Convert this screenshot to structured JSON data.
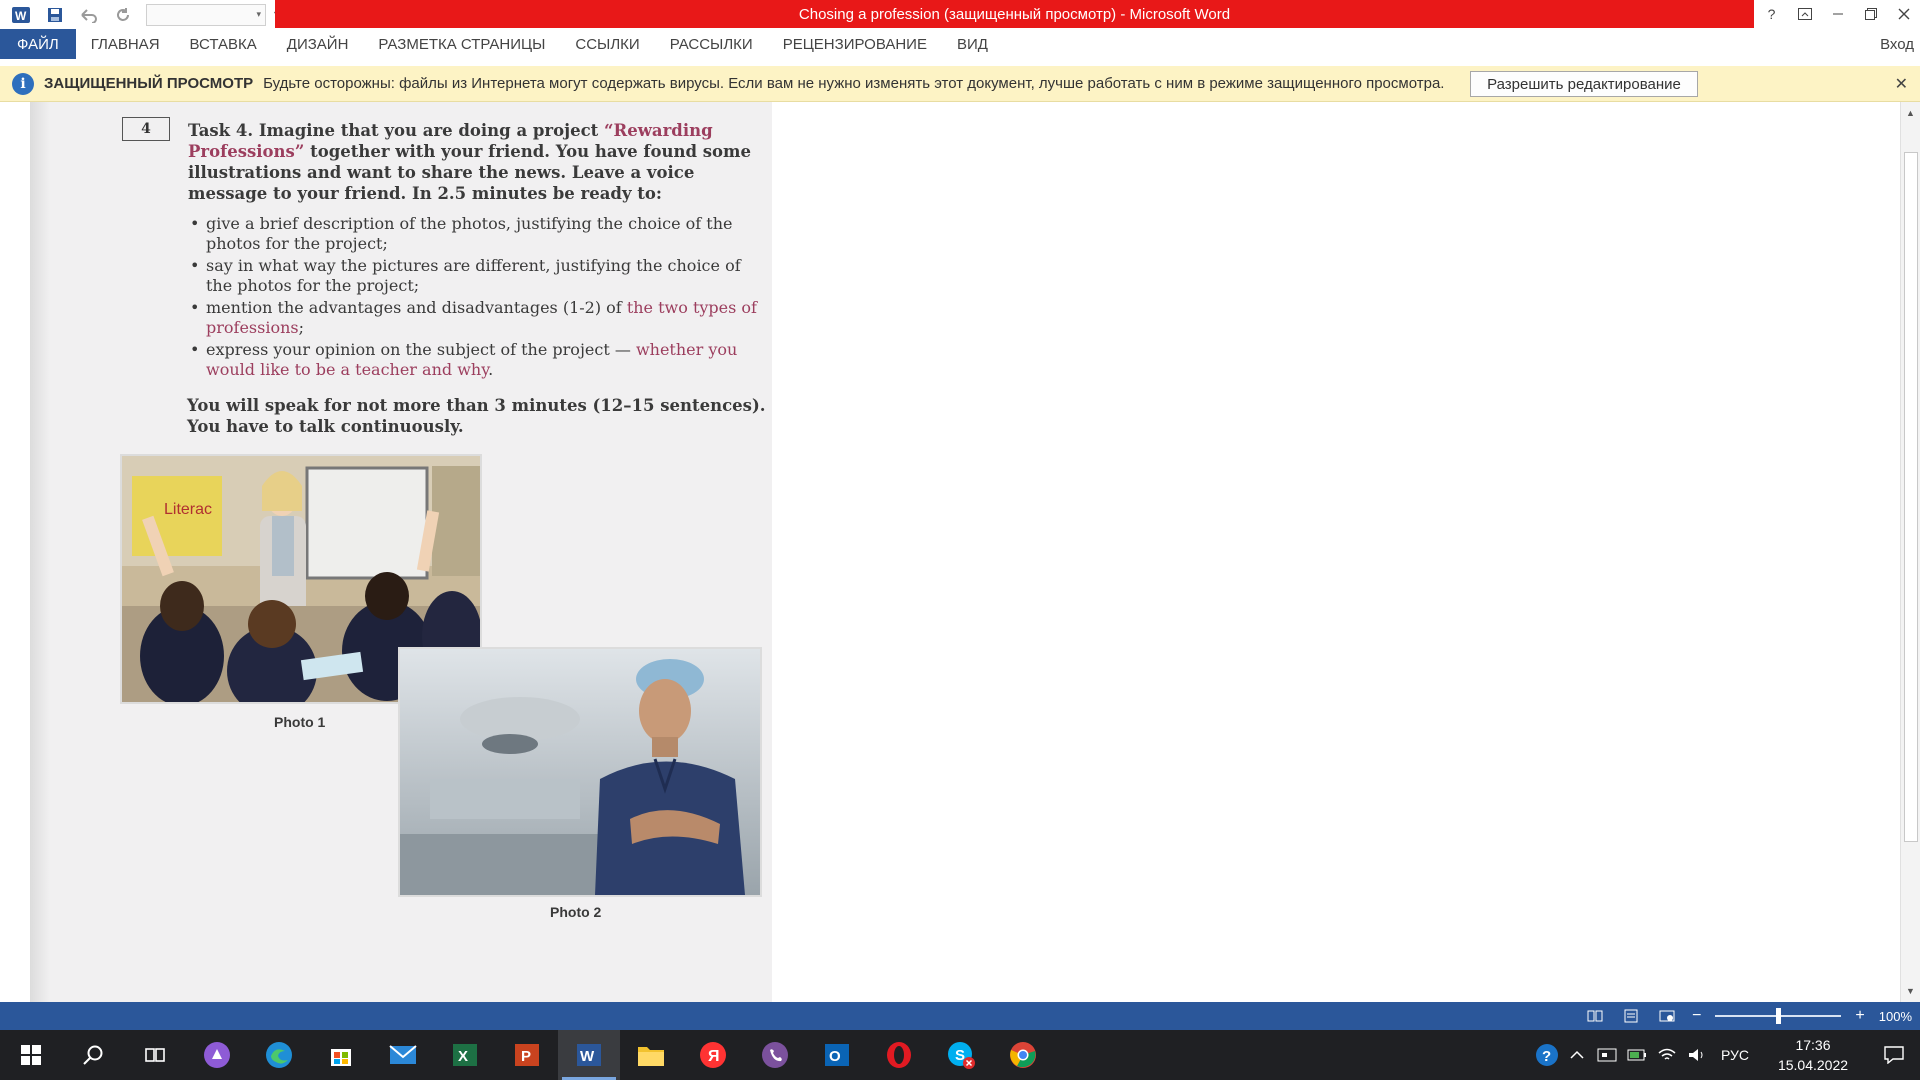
{
  "window": {
    "title": "Chosing a profession  (защищенный просмотр) -  Microsoft Word",
    "help": "?",
    "sign_in": "Вход"
  },
  "ribbon": {
    "tabs": [
      "ФАЙЛ",
      "ГЛАВНАЯ",
      "ВСТАВКА",
      "ДИЗАЙН",
      "РАЗМЕТКА СТРАНИЦЫ",
      "ССЫЛКИ",
      "РАССЫЛКИ",
      "РЕЦЕНЗИРОВАНИЕ",
      "ВИД"
    ]
  },
  "protected_view": {
    "title": "ЗАЩИЩЕННЫЙ ПРОСМОТР",
    "message": "Будьте осторожны: файлы из Интернета могут содержать вирусы. Если вам не нужно изменять этот документ, лучше работать с ним в режиме защищенного просмотра.",
    "button": "Разрешить редактирование"
  },
  "document": {
    "task_number": "4",
    "task_intro": "Task 4. Imagine that you are doing a project ",
    "project_name": "“Rewarding Professions”",
    "task_intro_rest": " together with your friend. You have found some illustrations and want to share the news. Leave a voice message to your friend. In 2.5 minutes be ready to:",
    "bullet1": "give a brief description of the photos, justifying the choice of the photos for the project;",
    "bullet2": "say in what way the pictures are different, justifying the choice of the photos for the project;",
    "bullet3_start": "mention the advantages and disadvantages (1-2) of ",
    "bullet3_accent": "the two types of professions",
    "bullet3_end": ";",
    "bullet4_start": "express your opinion on the subject of the project — ",
    "bullet4_accent": "whether you would like to be a teacher and why",
    "bullet4_end": ".",
    "speak_note_1": "You will speak for not more than 3 minutes (12–15 sentences).",
    "speak_note_2": "You have to talk continuously.",
    "photo1_caption": "Photo 1",
    "photo2_caption": "Photo 2",
    "photo1_board_text": "Literac"
  },
  "statusbar": {
    "zoom": "100%",
    "zoom_level": 1.0
  },
  "taskbar": {
    "apps": [
      "start",
      "search",
      "task-view",
      "pen",
      "edge",
      "store",
      "mail",
      "excel",
      "powerpoint",
      "word",
      "explorer",
      "yandex",
      "viber",
      "outlook",
      "opera",
      "skype",
      "chrome"
    ],
    "active_app": "word",
    "language": "РУС",
    "time": "17:36",
    "date": "15.04.2022"
  },
  "colors": {
    "title_bar": "#e81818",
    "ribbon_file": "#2b579a",
    "protected_bar": "#fdf3c5",
    "accent_text": "#9c3e5e",
    "status_bar": "#2b579a",
    "taskbar": "#1f2023"
  }
}
